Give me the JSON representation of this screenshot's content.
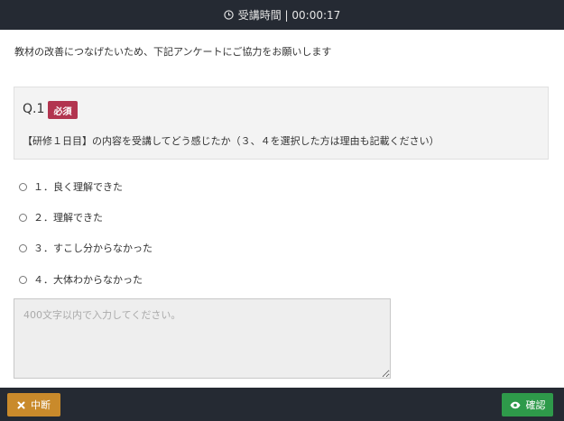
{
  "header": {
    "timer_label": "受講時間 | 00:00:17",
    "icon": "clock-icon"
  },
  "intro_text": "教材の改善につなげたいため、下記アンケートにご協力をお願いします",
  "question": {
    "number": "Q.1",
    "required_badge": "必須",
    "text": "【研修１日目】の内容を受講してどう感じたか（３、４を選択した方は理由も記載ください）",
    "options": [
      {
        "label": "１．良く理解できた"
      },
      {
        "label": "２．理解できた"
      },
      {
        "label": "３．すこし分からなかった"
      },
      {
        "label": "４．大体わからなかった"
      }
    ],
    "textarea": {
      "placeholder": "400文字以内で入力してください。",
      "value": ""
    }
  },
  "footer": {
    "suspend_label": "中断",
    "confirm_label": "確認",
    "suspend_icon": "close-icon",
    "confirm_icon": "eye-icon"
  },
  "colors": {
    "bar": "#252a33",
    "badge": "#b2344f",
    "suspend": "#c98a2b",
    "confirm": "#2e9a4a"
  }
}
